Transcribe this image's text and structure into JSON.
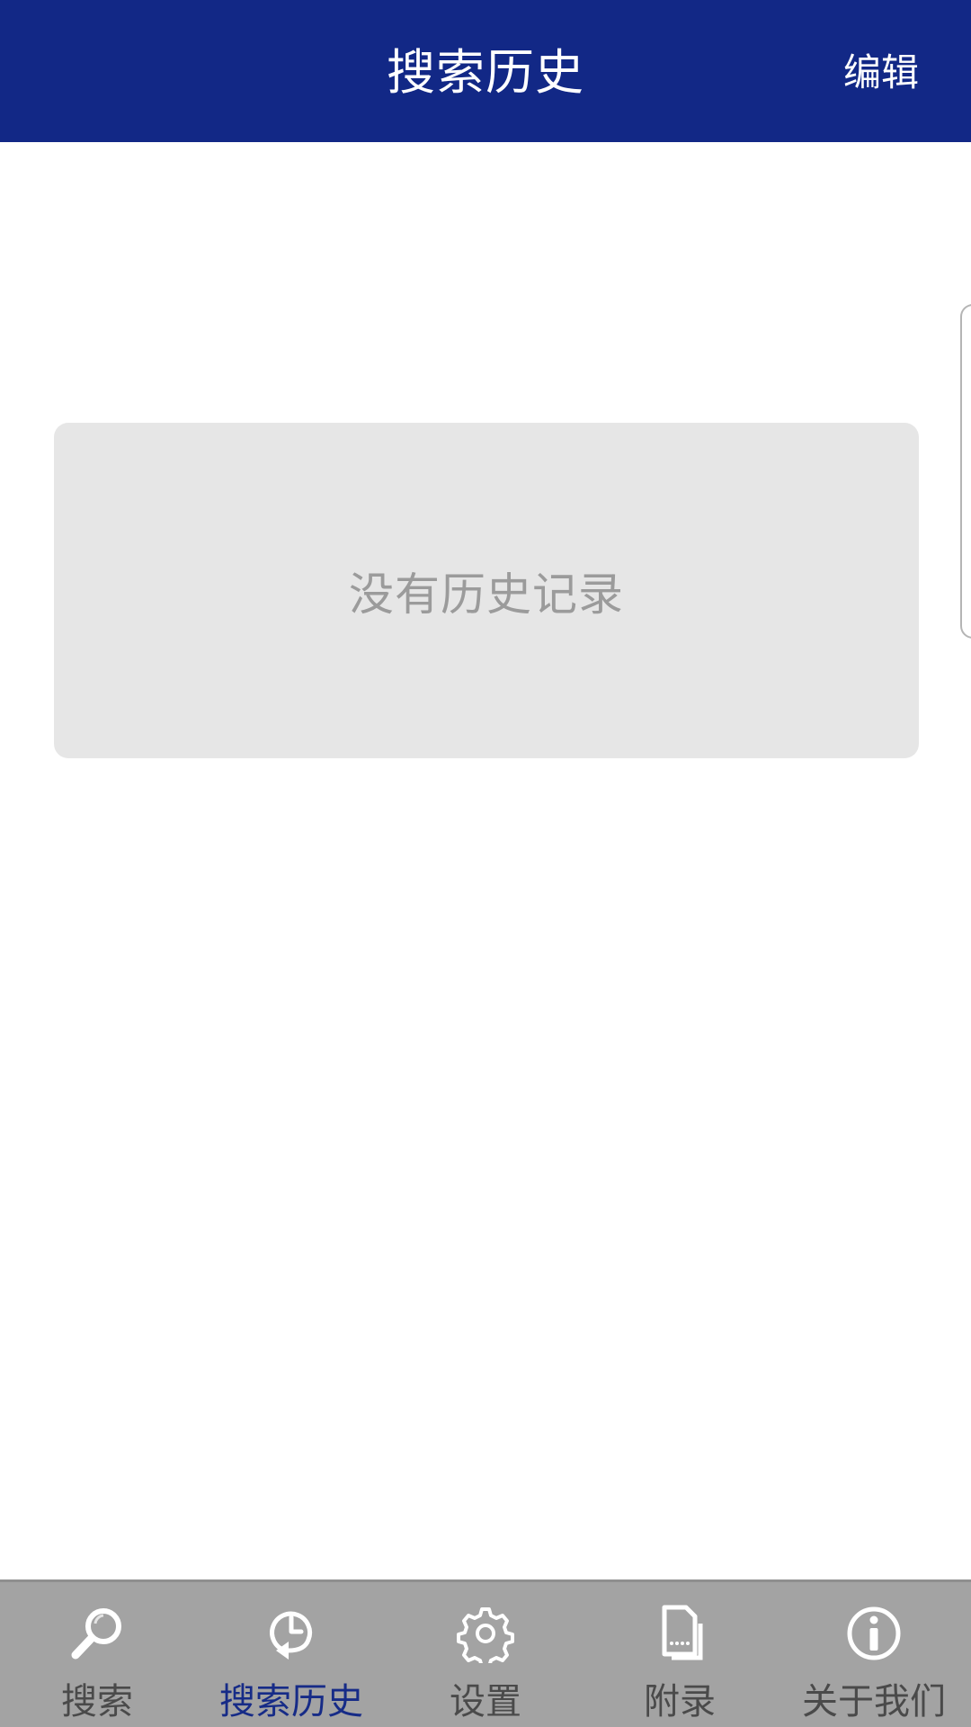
{
  "header": {
    "title": "搜索历史",
    "edit_label": "编辑"
  },
  "empty_state": {
    "message": "没有历史记录"
  },
  "tabbar": {
    "active_index": 1,
    "items": [
      {
        "label": "搜索",
        "icon": "search-icon"
      },
      {
        "label": "搜索历史",
        "icon": "history-icon"
      },
      {
        "label": "设置",
        "icon": "gear-icon"
      },
      {
        "label": "附录",
        "icon": "document-icon"
      },
      {
        "label": "关于我们",
        "icon": "info-icon"
      }
    ]
  },
  "colors": {
    "header_bg": "#122886",
    "active_tab": "#162b87",
    "tabbar_bg": "#a3a3a3",
    "empty_card_bg": "#e6e6e6"
  }
}
